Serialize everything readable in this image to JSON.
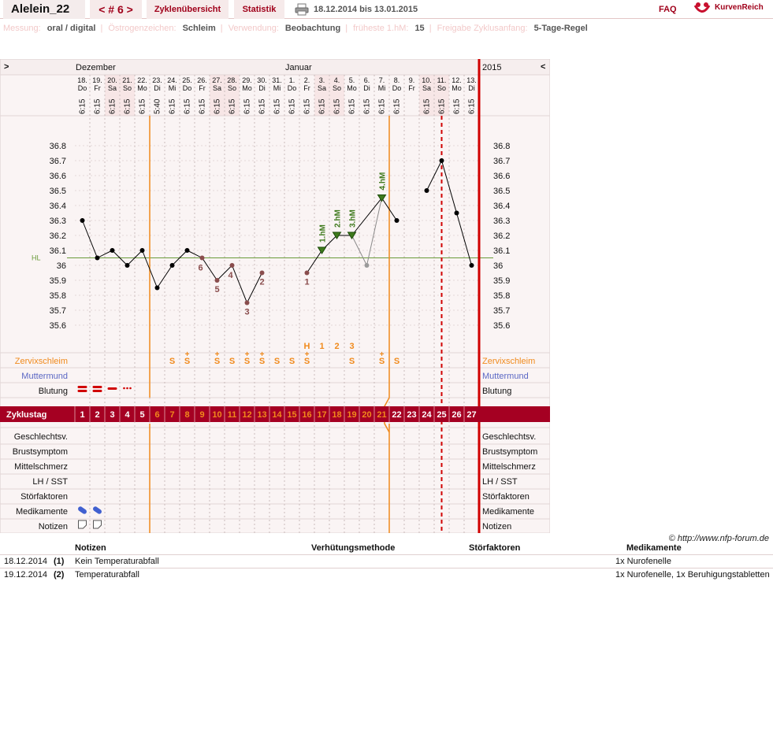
{
  "header": {
    "user": "Alelein_22",
    "cycle_label": "< # 6 >",
    "tab_overview": "Zyklenübersicht",
    "tab_stats": "Statistik",
    "date_range": "18.12.2014 bis 13.01.2015",
    "faq": "FAQ",
    "logo": "KurvenReich",
    "icons": [
      "printer-icon",
      "kurvenreich-logo-icon"
    ]
  },
  "info": {
    "messung_label": "Messung:",
    "messung_value": "oral / digital",
    "oestrogen_label": "Östrogenzeichen:",
    "oestrogen_value": "Schleim",
    "verwendung_label": "Verwendung:",
    "verwendung_value": "Beobachtung",
    "hm_label": "früheste 1.hM:",
    "hm_value": "15",
    "freigabe_label": "Freigabe Zyklusanfang:",
    "freigabe_value": "5-Tage-Regel"
  },
  "chart_data": {
    "type": "line",
    "year": "2015",
    "month_labels": [
      {
        "label": "Dezember",
        "day": 1
      },
      {
        "label": "Januar",
        "day": 15
      }
    ],
    "nav_prev": ">",
    "nav_next": "<",
    "days": [
      {
        "date": "18.",
        "wd": "Do",
        "time": "6:15",
        "temp": 36.3,
        "status": "normal",
        "we": false
      },
      {
        "date": "19.",
        "wd": "Fr",
        "time": "6:15",
        "temp": 36.05,
        "status": "normal",
        "we": false
      },
      {
        "date": "20.",
        "wd": "Sa",
        "time": "6:15",
        "temp": 36.1,
        "status": "normal",
        "we": true
      },
      {
        "date": "21.",
        "wd": "So",
        "time": "6:15",
        "temp": 36.0,
        "status": "normal",
        "we": true
      },
      {
        "date": "22.",
        "wd": "Mo",
        "time": "6:15",
        "temp": 36.1,
        "status": "normal",
        "we": false
      },
      {
        "date": "23.",
        "wd": "Di",
        "time": "5:40",
        "temp": 35.85,
        "status": "normal",
        "we": false
      },
      {
        "date": "24.",
        "wd": "Mi",
        "time": "6:15",
        "temp": 36.0,
        "status": "normal",
        "we": false
      },
      {
        "date": "25.",
        "wd": "Do",
        "time": "6:15",
        "temp": 36.1,
        "status": "normal",
        "we": false
      },
      {
        "date": "26.",
        "wd": "Fr",
        "time": "6:15",
        "temp": 36.05,
        "status": "low",
        "label": "6",
        "we": false
      },
      {
        "date": "27.",
        "wd": "Sa",
        "time": "6:15",
        "temp": 35.9,
        "status": "low",
        "label": "5",
        "we": true
      },
      {
        "date": "28.",
        "wd": "So",
        "time": "6:15",
        "temp": 36.0,
        "status": "low",
        "label": "4",
        "we": true
      },
      {
        "date": "29.",
        "wd": "Mo",
        "time": "6:15",
        "temp": 35.75,
        "status": "low",
        "label": "3",
        "we": false
      },
      {
        "date": "30.",
        "wd": "Di",
        "time": "6:15",
        "temp": 35.95,
        "status": "low",
        "label": "2",
        "we": false
      },
      {
        "date": "31.",
        "wd": "Mi",
        "time": "6:15",
        "temp": null,
        "we": false
      },
      {
        "date": "1.",
        "wd": "Do",
        "time": "6:15",
        "temp": null,
        "we": false
      },
      {
        "date": "2.",
        "wd": "Fr",
        "time": "6:15",
        "temp": 35.95,
        "status": "low",
        "label": "1",
        "we": false
      },
      {
        "date": "3.",
        "wd": "Sa",
        "time": "6:15",
        "temp": 36.1,
        "status": "high",
        "label": "1.hM",
        "we": true
      },
      {
        "date": "4.",
        "wd": "So",
        "time": "6:15",
        "temp": 36.2,
        "status": "high",
        "label": "2.hM",
        "we": true
      },
      {
        "date": "5.",
        "wd": "Mo",
        "time": "6:15",
        "temp": 36.2,
        "status": "high",
        "label": "3.hM",
        "we": false
      },
      {
        "date": "6.",
        "wd": "Di",
        "time": "6:15",
        "temp": 36.0,
        "status": "excluded",
        "we": false
      },
      {
        "date": "7.",
        "wd": "Mi",
        "time": "6:15",
        "temp": 36.45,
        "status": "high",
        "label": "4.hM",
        "we": false
      },
      {
        "date": "8.",
        "wd": "Do",
        "time": "6:15",
        "temp": 36.3,
        "status": "normal",
        "we": false
      },
      {
        "date": "9.",
        "wd": "Fr",
        "time": "",
        "temp": null,
        "we": false
      },
      {
        "date": "10.",
        "wd": "Sa",
        "time": "6:15",
        "temp": 36.5,
        "status": "normal",
        "we": true
      },
      {
        "date": "11.",
        "wd": "So",
        "time": "6:15",
        "temp": 36.7,
        "status": "normal",
        "we": true
      },
      {
        "date": "12.",
        "wd": "Mo",
        "time": "6:15",
        "temp": 36.35,
        "status": "normal",
        "we": false
      },
      {
        "date": "13.",
        "wd": "Di",
        "time": "6:15",
        "temp": 36.0,
        "status": "normal",
        "we": false
      }
    ],
    "y_ticks": [
      "36.8",
      "36.7",
      "36.6",
      "36.5",
      "36.4",
      "36.3",
      "36.2",
      "36.1",
      "36",
      "35.9",
      "35.8",
      "35.7",
      "35.6"
    ],
    "ylim": [
      35.6,
      36.8
    ],
    "hl_label": "HL",
    "hl_value": 36.05,
    "orange_lines_after_day": [
      5,
      21
    ],
    "dashed_line_day": 25,
    "mucus_peak_labels": [
      {
        "day": 16,
        "text": "H"
      },
      {
        "day": 17,
        "text": "1"
      },
      {
        "day": 18,
        "text": "2"
      },
      {
        "day": 19,
        "text": "3"
      }
    ],
    "mucus": [
      "",
      "",
      "",
      "",
      "",
      "",
      "S",
      "S+",
      "",
      "S+",
      "S",
      "S+",
      "S+",
      "S",
      "S",
      "S+",
      "",
      "",
      "S",
      "",
      "S+",
      "S",
      "",
      "",
      "",
      "",
      ""
    ],
    "bleeding": [
      "heavy",
      "heavy",
      "medium",
      "spotting",
      "",
      "",
      "",
      "",
      "",
      "",
      "",
      "",
      "",
      "",
      "",
      "",
      "",
      "",
      "",
      "",
      "",
      "",
      "",
      "",
      "",
      "",
      ""
    ],
    "medication_days": [
      1,
      2
    ],
    "notes_days": [
      1,
      2
    ],
    "rows_left": {
      "zervix": "Zervixschleim",
      "muttermund": "Muttermund",
      "blutung": "Blutung",
      "zyklustag": "Zyklustag",
      "gv": "Geschlechtsv.",
      "brust": "Brustsymptom",
      "mittel": "Mittelschmerz",
      "lh": "LH / SST",
      "stoer": "Störfaktoren",
      "medi": "Medikamente",
      "notiz": "Notizen"
    },
    "colors": {
      "grid": "#c9bcbc",
      "orange": "#f08a1c",
      "red": "#d00000",
      "dark_red": "#a50022",
      "low_point": "#8a4d4d",
      "high_point": "#3f7a1d",
      "hl_line": "#6a9a3a",
      "weekend": "#f7e6e6",
      "panel": "#faf4f4"
    }
  },
  "copyright": "© http://www.nfp-forum.de",
  "notes_table": {
    "headers": {
      "notizen": "Notizen",
      "verhuetung": "Verhütungsmethode",
      "stoer": "Störfaktoren",
      "medi": "Medikamente"
    },
    "rows": [
      {
        "date": "18.12.2014",
        "nr": "(1)",
        "note": "Kein Temperaturabfall",
        "medi": "1x Nurofenelle"
      },
      {
        "date": "19.12.2014",
        "nr": "(2)",
        "note": "Temperaturabfall",
        "medi": "1x Nurofenelle, 1x Beruhigungstabletten"
      }
    ]
  }
}
